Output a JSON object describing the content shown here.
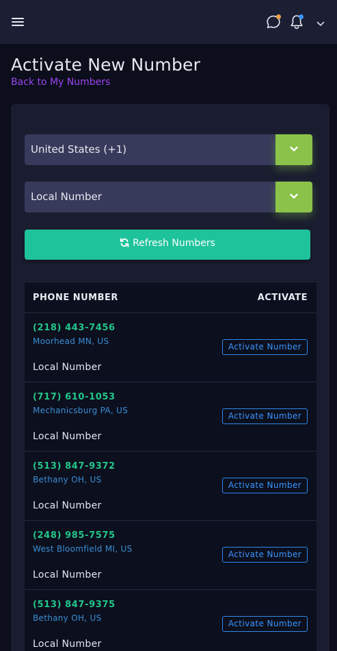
{
  "header": {
    "icons": [
      "menu-icon",
      "chat-icon",
      "bell-icon",
      "chevron-down-icon"
    ],
    "chat_badge_color": "#f0a04b",
    "bell_badge_color": "#3a96ff"
  },
  "page": {
    "title": "Activate New Number",
    "back_link": "Back to My Numbers"
  },
  "form": {
    "country_select": "United States (+1)",
    "type_select": "Local Number",
    "refresh_label": "Refresh Numbers"
  },
  "table": {
    "columns": [
      "PHONE NUMBER",
      "ACTIVATE"
    ],
    "rows": [
      {
        "phone": "(218) 443-7456",
        "location": "Moorhead MN, US",
        "type": "Local Number",
        "action": "Activate Number"
      },
      {
        "phone": "(717) 610-1053",
        "location": "Mechanicsburg PA, US",
        "type": "Local Number",
        "action": "Activate Number"
      },
      {
        "phone": "(513) 847-9372",
        "location": "Bethany OH, US",
        "type": "Local Number",
        "action": "Activate Number"
      },
      {
        "phone": "(248) 985-7575",
        "location": "West Bloomfield MI, US",
        "type": "Local Number",
        "action": "Activate Number"
      },
      {
        "phone": "(513) 847-9375",
        "location": "Bethany OH, US",
        "type": "Local Number",
        "action": "Activate Number"
      }
    ]
  },
  "colors": {
    "accent_green": "#8bc34a",
    "refresh_teal": "#1fc39b",
    "phone_green": "#23c68a",
    "link_purple": "#9a44f2",
    "action_blue": "#3a96ff"
  }
}
